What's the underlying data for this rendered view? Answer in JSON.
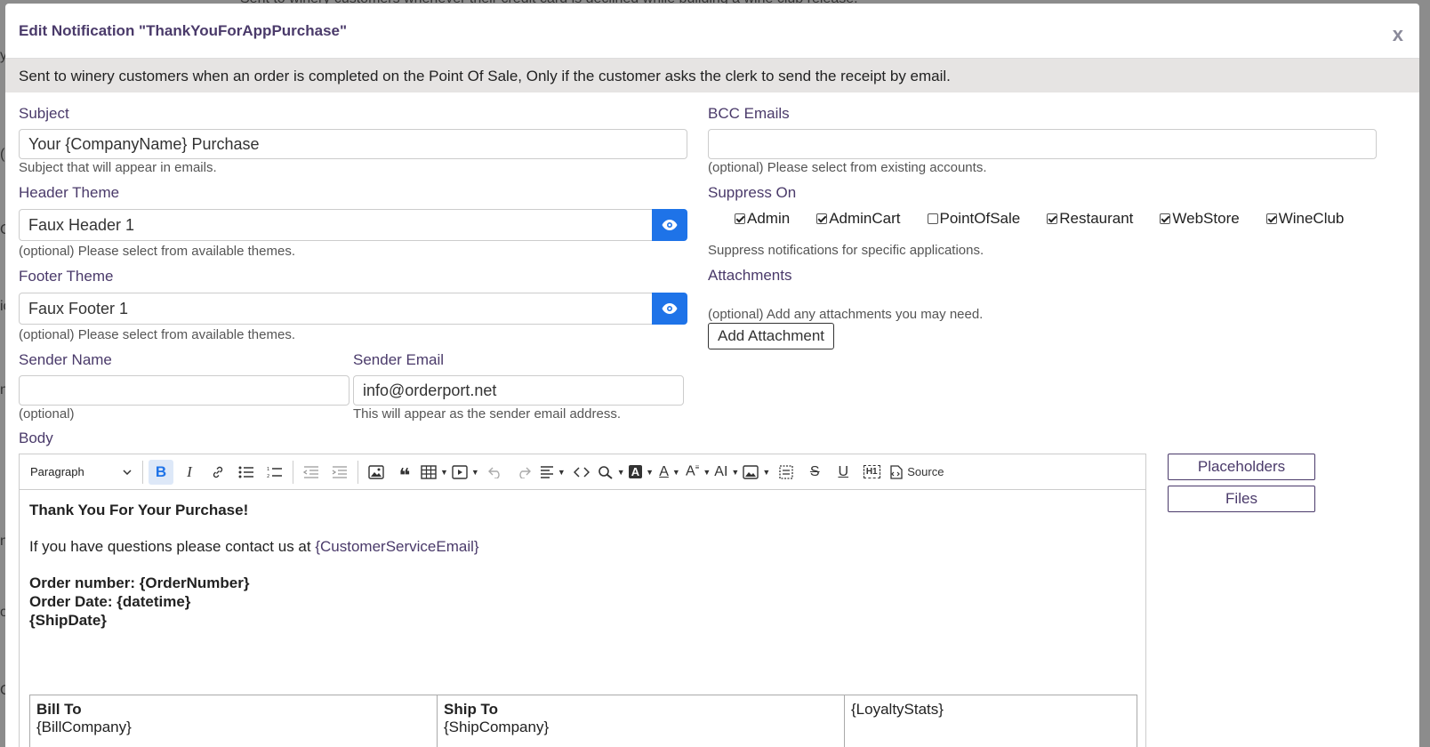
{
  "background_text": {
    "line1": "Sent to winery customers whenever their credit card is declined while building a wine club release.",
    "side": [
      "y",
      "(",
      "ic",
      "n",
      "C",
      "n",
      "o",
      "C"
    ]
  },
  "modal": {
    "title": "Edit Notification \"ThankYouForAppPurchase\"",
    "close_label": "x",
    "description": "Sent to winery customers when an order is completed on the Point Of Sale, Only if the customer asks the clerk to send the receipt by email."
  },
  "subject": {
    "label": "Subject",
    "value": "Your {CompanyName} Purchase",
    "help": "Subject that will appear in emails."
  },
  "header_theme": {
    "label": "Header Theme",
    "value": "Faux Header 1",
    "help": "(optional) Please select from available themes."
  },
  "footer_theme": {
    "label": "Footer Theme",
    "value": "Faux Footer 1",
    "help": "(optional) Please select from available themes."
  },
  "sender_name": {
    "label": "Sender Name",
    "value": "",
    "help": "(optional)"
  },
  "sender_email": {
    "label": "Sender Email",
    "value": "info@orderport.net",
    "help": "This will appear as the sender email address."
  },
  "bcc": {
    "label": "BCC Emails",
    "value": "",
    "help": "(optional) Please select from existing accounts."
  },
  "suppress": {
    "label": "Suppress On",
    "help": "Suppress notifications for specific applications.",
    "options": [
      {
        "label": "Admin",
        "checked": true
      },
      {
        "label": "AdminCart",
        "checked": true
      },
      {
        "label": "PointOfSale",
        "checked": false
      },
      {
        "label": "Restaurant",
        "checked": true
      },
      {
        "label": "WebStore",
        "checked": true
      },
      {
        "label": "WineClub",
        "checked": true
      }
    ]
  },
  "attachments": {
    "label": "Attachments",
    "help": "(optional) Add any attachments you may need.",
    "button": "Add Attachment"
  },
  "body": {
    "label": "Body",
    "toolbar": {
      "block_format": "Paragraph",
      "source_label": "Source"
    },
    "content": {
      "heading": "Thank You For Your Purchase!",
      "contact_text": "If you have questions please contact us at ",
      "contact_placeholder": "{CustomerServiceEmail}",
      "order_number": "Order number: {OrderNumber}",
      "order_date": "Order Date: {datetime}",
      "ship_date": "{ShipDate}",
      "table": {
        "bill_to": "Bill To",
        "bill_company": "{BillCompany}",
        "ship_to": "Ship To",
        "ship_company": "{ShipCompany}",
        "loyalty": "{LoyaltyStats}"
      }
    }
  },
  "side_buttons": {
    "placeholders": "Placeholders",
    "files": "Files"
  },
  "colors": {
    "accent": "#1e73e8",
    "label": "#4a3a6a",
    "desc_bg": "#e6e4e3"
  }
}
